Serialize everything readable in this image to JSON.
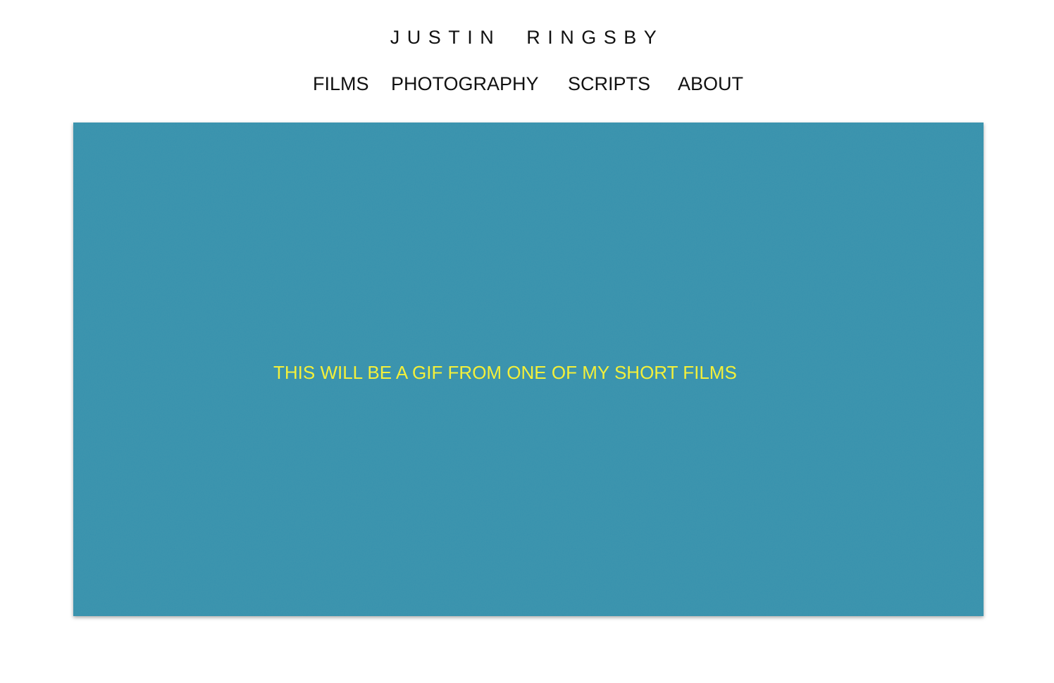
{
  "header": {
    "title": "JUSTIN  RINGSBY"
  },
  "nav": {
    "items": [
      {
        "label": "FILMS"
      },
      {
        "label": "PHOTOGRAPHY"
      },
      {
        "label": "SCRIPTS"
      },
      {
        "label": "ABOUT"
      }
    ]
  },
  "hero": {
    "caption": "THIS WILL BE A GIF FROM ONE OF MY SHORT FILMS",
    "background_color": "#3591ad",
    "caption_color": "#f4f03a"
  }
}
